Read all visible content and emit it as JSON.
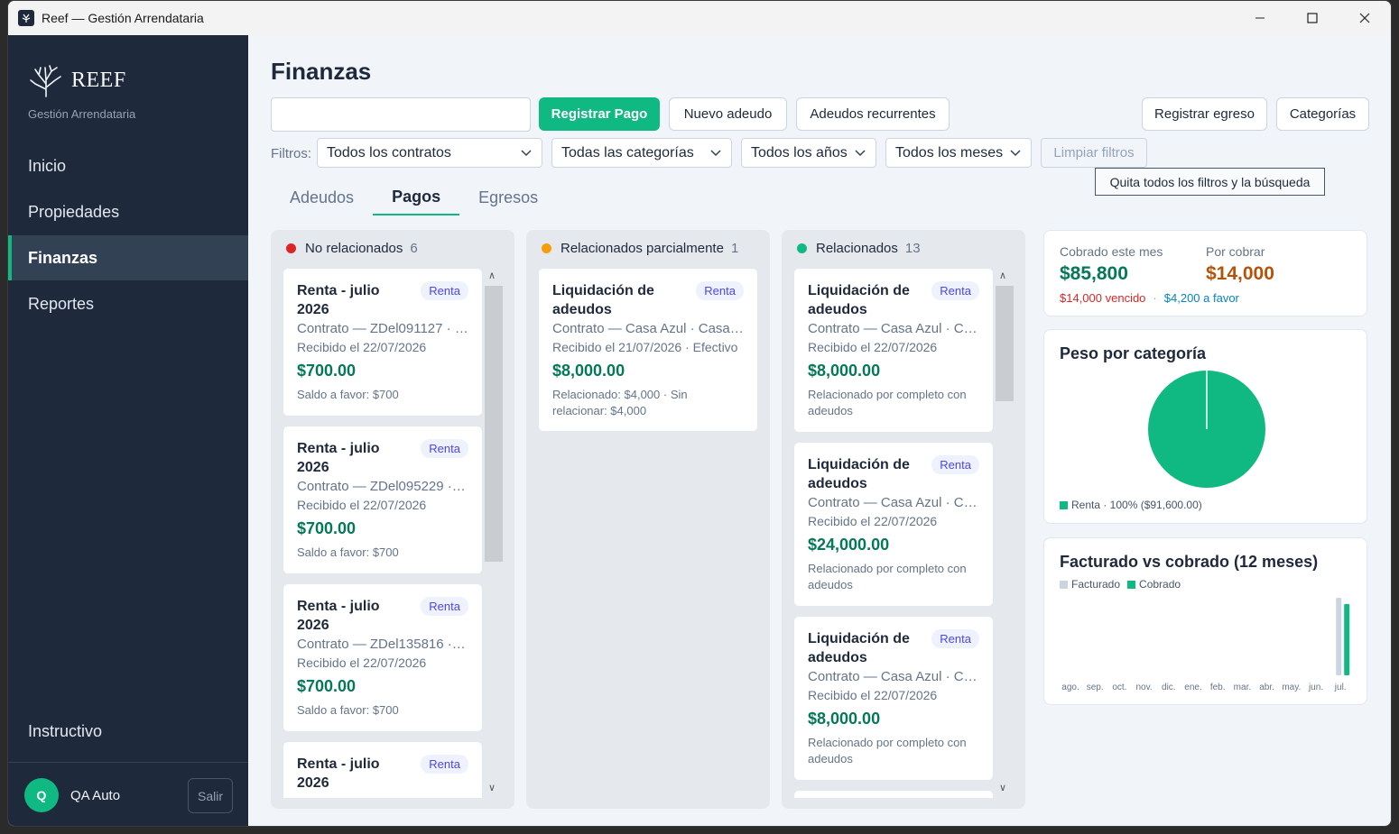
{
  "window": {
    "title": "Reef — Gestión Arrendataria"
  },
  "sidebar": {
    "brand": "REEF",
    "subtitle": "Gestión Arrendataria",
    "items": [
      {
        "label": "Inicio"
      },
      {
        "label": "Propiedades"
      },
      {
        "label": "Finanzas",
        "active": true
      },
      {
        "label": "Reportes"
      }
    ],
    "bottom_link": "Instructivo",
    "user": {
      "initial": "Q",
      "name": "QA Auto",
      "logout": "Salir"
    }
  },
  "main": {
    "title": "Finanzas",
    "search": {
      "value": "",
      "placeholder": ""
    },
    "actions": {
      "register_payment": "Registrar Pago",
      "new_debt": "Nuevo adeudo",
      "recurring": "Adeudos recurrentes",
      "register_expense": "Registrar egreso",
      "categories": "Categorías"
    },
    "filters": {
      "label": "Filtros:",
      "contract": "Todos los contratos",
      "category": "Todas las categorías",
      "year": "Todos los años",
      "month": "Todos los meses",
      "clear": "Limpiar filtros",
      "clear_tooltip": "Quita todos los filtros y la búsqueda"
    },
    "tabs": [
      {
        "label": "Adeudos"
      },
      {
        "label": "Pagos",
        "active": true
      },
      {
        "label": "Egresos"
      }
    ]
  },
  "columns": [
    {
      "title": "No relacionados",
      "count": "6",
      "color": "#dc2626",
      "cards": [
        {
          "title": "Renta - julio 2026",
          "badge": "Renta",
          "contract": "Contrato — ZDel091127 · Z...",
          "received": "Recibido el 22/07/2026",
          "amount": "$700.00",
          "note": "Saldo a favor: $700"
        },
        {
          "title": "Renta - julio 2026",
          "badge": "Renta",
          "contract": "Contrato — ZDel095229 · Z...",
          "received": "Recibido el 22/07/2026",
          "amount": "$700.00",
          "note": "Saldo a favor: $700"
        },
        {
          "title": "Renta - julio 2026",
          "badge": "Renta",
          "contract": "Contrato — ZDel135816 · Z...",
          "received": "Recibido el 22/07/2026",
          "amount": "$700.00",
          "note": "Saldo a favor: $700"
        },
        {
          "title": "Renta - julio 2026",
          "badge": "Renta"
        }
      ]
    },
    {
      "title": "Relacionados parcialmente",
      "count": "1",
      "color": "#f59e0b",
      "cards": [
        {
          "title": "Liquidación de adeudos",
          "badge": "Renta",
          "contract": "Contrato — Casa Azul · Casa A...",
          "received": "Recibido el 21/07/2026 · Efectivo",
          "amount": "$8,000.00",
          "note": "Relacionado: $4,000 · Sin relacionar: $4,000"
        }
      ]
    },
    {
      "title": "Relacionados",
      "count": "13",
      "color": "#10b981",
      "cards": [
        {
          "title": "Liquidación de adeudos",
          "badge": "Renta",
          "contract": "Contrato — Casa Azul · Cas...",
          "received": "Recibido el 22/07/2026",
          "amount": "$8,000.00",
          "note": "Relacionado por completo con adeudos"
        },
        {
          "title": "Liquidación de adeudos",
          "badge": "Renta",
          "contract": "Contrato — Casa Azul · Cas...",
          "received": "Recibido el 22/07/2026",
          "amount": "$24,000.00",
          "note": "Relacionado por completo con adeudos"
        },
        {
          "title": "Liquidación de adeudos",
          "badge": "Renta",
          "contract": "Contrato — Casa Azul · Cas...",
          "received": "Recibido el 22/07/2026",
          "amount": "$8,000.00",
          "note": "Relacionado por completo con adeudos"
        }
      ]
    }
  ],
  "summary": {
    "collected_label": "Cobrado este mes",
    "collected_value": "$85,800",
    "pending_label": "Por cobrar",
    "pending_value": "$14,000",
    "overdue": "$14,000 vencido",
    "separator": "·",
    "credit": "$4,200 a favor",
    "colors": {
      "collected": "#047857",
      "pending": "#b45309",
      "overdue": "#dc2626",
      "credit": "#0284c7"
    }
  },
  "chart_data": [
    {
      "type": "pie",
      "title": "Peso por categoría",
      "categories": [
        "Renta"
      ],
      "values": [
        91600
      ],
      "legend": [
        "Renta · 100% ($91,600.00)"
      ],
      "colors": [
        "#10b981"
      ]
    },
    {
      "type": "bar",
      "title": "Facturado vs cobrado (12 meses)",
      "categories": [
        "ago.",
        "sep.",
        "oct.",
        "nov.",
        "dic.",
        "ene.",
        "feb.",
        "mar.",
        "abr.",
        "may.",
        "jun.",
        "jul."
      ],
      "series": [
        {
          "name": "Facturado",
          "color": "#cbd5e1",
          "values": [
            0,
            0,
            0,
            0,
            0,
            0,
            0,
            0,
            0,
            0,
            0,
            100
          ]
        },
        {
          "name": "Cobrado",
          "color": "#10b981",
          "values": [
            0,
            0,
            0,
            0,
            0,
            0,
            0,
            0,
            0,
            0,
            0,
            92
          ]
        }
      ],
      "ylim": [
        0,
        100
      ]
    }
  ]
}
